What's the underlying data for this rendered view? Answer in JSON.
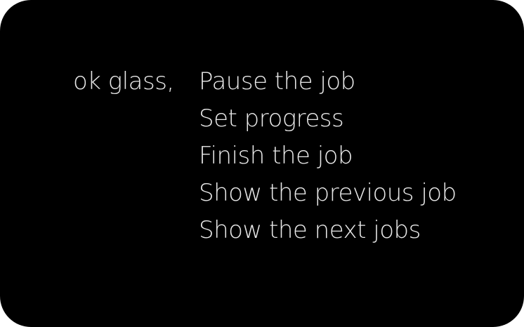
{
  "voice_menu": {
    "hotword": "ok glass,",
    "commands": [
      {
        "label": "Pause the job"
      },
      {
        "label": "Set progress"
      },
      {
        "label": "Finish the job"
      },
      {
        "label": "Show the previous job"
      },
      {
        "label": "Show the next jobs"
      }
    ]
  },
  "colors": {
    "background": "#000000",
    "text": "#e8e8e8"
  }
}
